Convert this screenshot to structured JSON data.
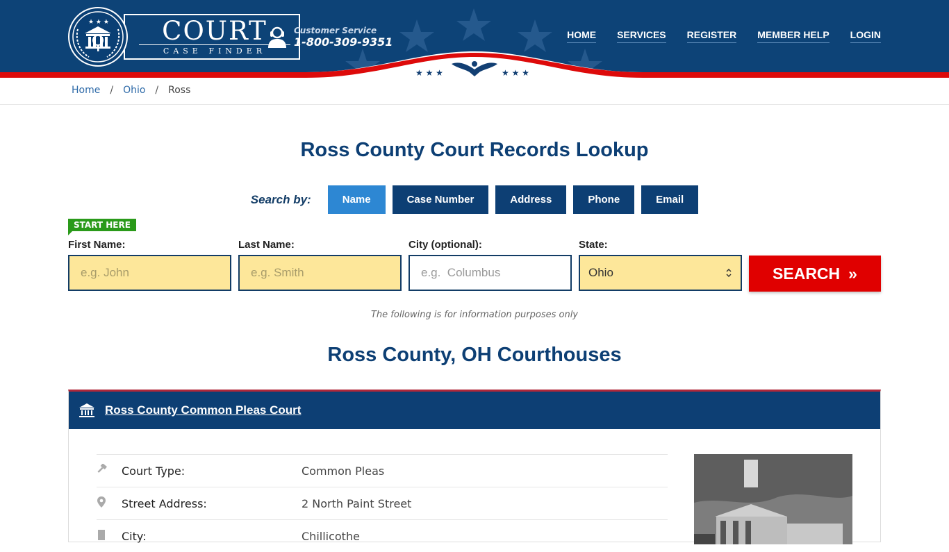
{
  "header": {
    "logo_title": "COURT",
    "logo_subtitle": "CASE FINDER",
    "customer_service_label": "Customer Service",
    "customer_service_phone": "1-800-309-9351",
    "nav": [
      "HOME",
      "SERVICES",
      "REGISTER",
      "MEMBER HELP",
      "LOGIN"
    ]
  },
  "breadcrumb": {
    "items": [
      "Home",
      "Ohio",
      "Ross"
    ],
    "separator": "/"
  },
  "page_title": "Ross County Court Records Lookup",
  "search": {
    "search_by_label": "Search by:",
    "tabs": [
      "Name",
      "Case Number",
      "Address",
      "Phone",
      "Email"
    ],
    "active_tab": "Name",
    "start_here": "START HERE",
    "fields": {
      "first_name": {
        "label": "First Name:",
        "placeholder": "e.g. John",
        "value": ""
      },
      "last_name": {
        "label": "Last Name:",
        "placeholder": "e.g. Smith",
        "value": ""
      },
      "city": {
        "label": "City (optional):",
        "placeholder": "e.g.  Columbus",
        "value": ""
      },
      "state": {
        "label": "State:",
        "value": "Ohio"
      }
    },
    "search_button": "SEARCH",
    "search_button_icon": "»"
  },
  "disclaimer": "The following is for information purposes only",
  "courthouses_title": "Ross County, OH Courthouses",
  "courthouse": {
    "name": "Ross County Common Pleas Court",
    "rows": [
      {
        "icon": "gavel-icon",
        "label": "Court Type:",
        "value": "Common Pleas"
      },
      {
        "icon": "map-pin-icon",
        "label": "Street Address:",
        "value": "2 North Paint Street"
      },
      {
        "icon": "building-icon",
        "label": "City:",
        "value": "Chillicothe"
      }
    ]
  },
  "colors": {
    "primary": "#0d3f74",
    "accent_red": "#e00000",
    "active_tab": "#2d87d3",
    "input_fill": "#fde79a",
    "start_here": "#2a9a1a"
  }
}
